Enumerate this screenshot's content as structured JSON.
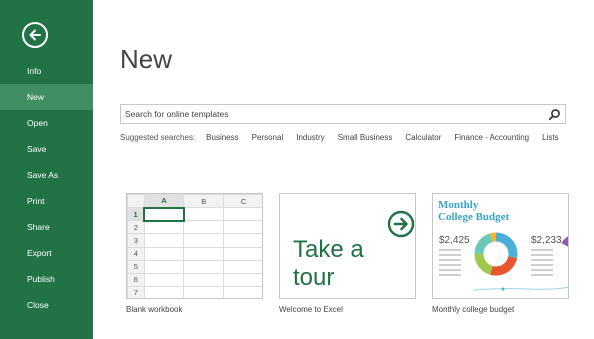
{
  "sidebar": {
    "items": [
      {
        "label": "Info"
      },
      {
        "label": "New",
        "active": true
      },
      {
        "label": "Open"
      },
      {
        "label": "Save"
      },
      {
        "label": "Save As"
      },
      {
        "label": "Print"
      },
      {
        "label": "Share"
      },
      {
        "label": "Export"
      },
      {
        "label": "Publish"
      },
      {
        "label": "Close"
      }
    ]
  },
  "main": {
    "title": "New",
    "search": {
      "placeholder": "Search for online templates",
      "value": ""
    },
    "suggested_label": "Suggested searches:",
    "suggested": [
      "Business",
      "Personal",
      "Industry",
      "Small Business",
      "Calculator",
      "Finance - Accounting",
      "Lists"
    ]
  },
  "templates": {
    "blank": {
      "label": "Blank workbook",
      "columns": [
        "A",
        "B",
        "C"
      ],
      "rows": [
        "1",
        "2",
        "3",
        "4",
        "5",
        "6",
        "7"
      ]
    },
    "tour": {
      "label": "Welcome to Excel",
      "line1": "Take a",
      "line2": "tour"
    },
    "budget": {
      "label": "Monthly college budget",
      "title1": "Monthly",
      "title2": "College Budget",
      "amount_left": "$2,425",
      "amount_right": "$2,233"
    }
  },
  "colors": {
    "accent": "#217346",
    "sidebar_active": "#3f8f63"
  }
}
